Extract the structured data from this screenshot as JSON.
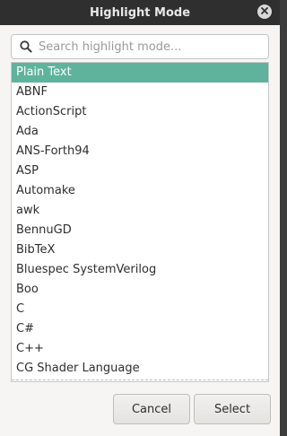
{
  "window": {
    "title": "Highlight Mode"
  },
  "search": {
    "placeholder": "Search highlight mode..."
  },
  "list": {
    "items": [
      "Plain Text",
      "ABNF",
      "ActionScript",
      "Ada",
      "ANS-Forth94",
      "ASP",
      "Automake",
      "awk",
      "BennuGD",
      "BibTeX",
      "Bluespec SystemVerilog",
      "Boo",
      "C",
      "C#",
      "C++",
      "CG Shader Language"
    ],
    "selected_index": 0
  },
  "buttons": {
    "cancel_label": "Cancel",
    "select_label": "Select"
  },
  "colors": {
    "accent": "#5fb39c",
    "titlebar": "#2f2f2f"
  },
  "icons": {
    "close": "close-icon",
    "search": "search-icon"
  }
}
